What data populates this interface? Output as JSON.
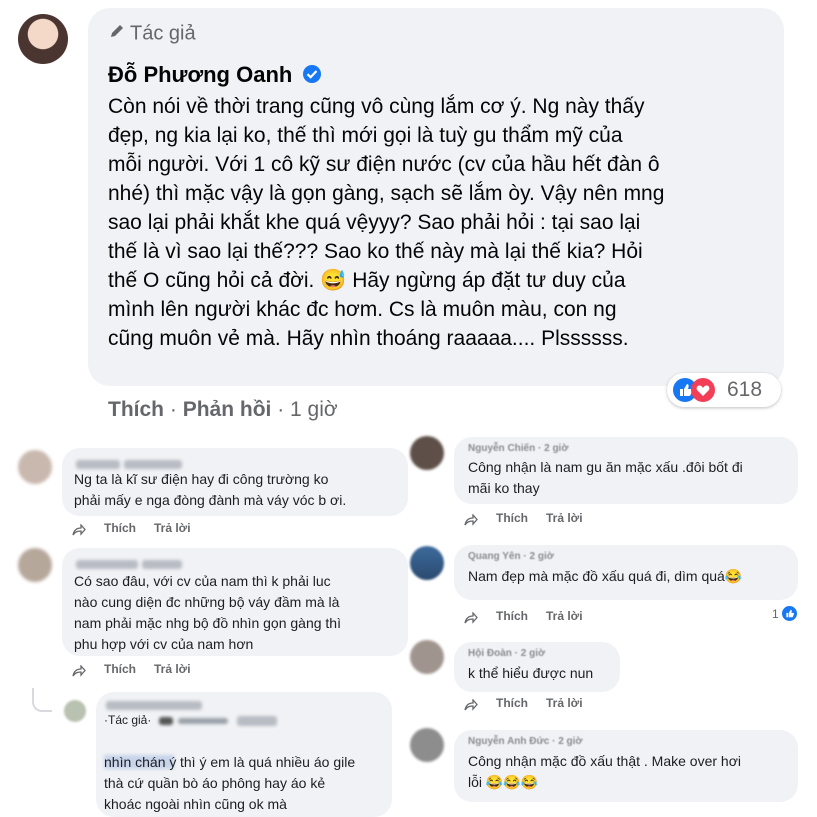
{
  "main_post": {
    "author_badge": "Tác giả",
    "author_name": "Đỗ Phương Oanh",
    "text": "Còn nói về thời trang cũng vô cùng lắm cơ ý. Ng này thấy\nđẹp, ng kia lại ko, thế thì mới gọi là tuỳ gu thẩm mỹ của\nmỗi người. Với 1 cô kỹ sư điện nước (cv của hầu hết đàn ô\nnhé) thì mặc vậy là gọn gàng, sạch sẽ lắm òy. Vậy nên mng\nsao lại phải khắt khe quá vệyyy? Sao phải hỏi : tại sao lại\nthế là vì sao lại thế??? Sao ko thế này mà lại thế kia? Hỏi\nthế O cũng hỏi cả đời. 😅 Hãy ngừng áp đặt tư duy của\nmình lên người khác đc hơm. Cs là muôn màu, con ng\ncũng muôn vẻ mà. Hãy nhìn thoáng raaaaa.... Plssssss.",
    "reaction_count": "618",
    "actions": {
      "like": "Thích",
      "reply": "Phản hồi",
      "sep": "·",
      "time": "1 giờ"
    }
  },
  "comments_left": [
    {
      "name": "Hải Chiến",
      "text": "Ng ta là kĩ sư điện hay đi công trường ko\nphải mấy e nga đòng đành mà váy vóc b ơi.",
      "like": "Thích",
      "reply": "Trả lời"
    },
    {
      "name": "Nguyễn Bình",
      "text": "Có sao đâu, với cv của nam thì k phải luc\nnào cung diện đc những bộ váy đầm mà là\nnam phải mặc nhg bộ đồ nhìn gọn gàng thì\nphu hợp với cv của nam hơn",
      "like": "Thích",
      "reply": "Trả lời"
    }
  ],
  "reply_box": {
    "badge": "·Tác giả·",
    "name": "Đỗ Phương Oanh",
    "mention": "Nguyễn",
    "text_first": "thì ý em là quá nhiều áo gile",
    "text_rest": "nhìn chán ý\nthà cứ quần bò áo phông hay áo kẻ\nkhoác ngoài nhìn cũng ok mà"
  },
  "comments_right": [
    {
      "name": "Nguyễn Chiến · 2 giờ",
      "text": "Công nhận là nam gu ăn mặc xấu .đôi bốt đi\nmãi ko thay",
      "like": "Thích",
      "reply": "Trả lời"
    },
    {
      "name": "Quang Yên · 2 giờ",
      "text": "Nam đẹp mà mặc đồ xấu quá đi, dìm quá😂",
      "like": "Thích",
      "reply": "Trả lời",
      "likes": "1"
    },
    {
      "name": "Hội Đoàn · 2 giờ",
      "text": "k thể hiểu được nun",
      "like": "Thích",
      "reply": "Trả lời"
    },
    {
      "name": "Nguyễn Anh Đức · 2 giờ",
      "text": "Công nhận mặc đồ xấu thật . Make over hơi\nlỗi 😂😂😂",
      "like": "Thích",
      "reply": "Trả lời"
    }
  ],
  "colors": {
    "bubble": "#f0f2f5",
    "link": "#385898",
    "like_blue": "#1877f2",
    "love_red": "#f33e58"
  },
  "icons": [
    "pen-icon",
    "verified-icon",
    "like-reaction-icon",
    "love-reaction-icon",
    "share-icon"
  ]
}
